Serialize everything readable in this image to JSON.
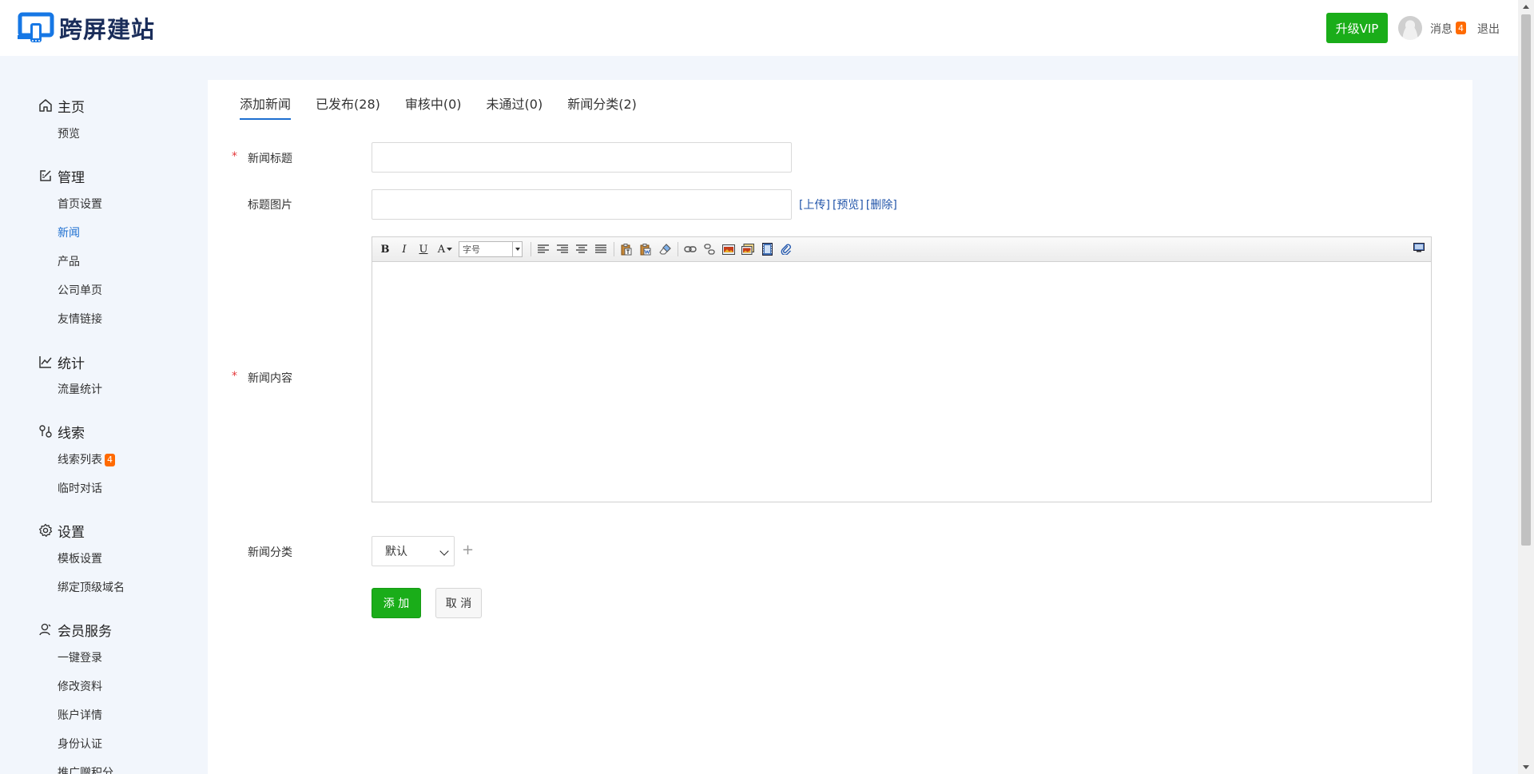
{
  "brand": {
    "name": "跨屏建站",
    "color": "#1677e5"
  },
  "header": {
    "vip_label": "升级VIP",
    "messages_label": "消息",
    "messages_count": "4",
    "logout_label": "退出"
  },
  "sidebar": {
    "sections": [
      {
        "title": "主页",
        "icon": "home-icon",
        "items": [
          "预览"
        ]
      },
      {
        "title": "管理",
        "icon": "edit-icon",
        "items": [
          "首页设置",
          "新闻",
          "产品",
          "公司单页",
          "友情链接"
        ],
        "active": "新闻"
      },
      {
        "title": "统计",
        "icon": "chart-line-icon",
        "items": [
          "流量统计"
        ]
      },
      {
        "title": "线索",
        "icon": "clue-icon",
        "items": [
          "线索列表",
          "临时对话"
        ],
        "badge": {
          "item": "线索列表",
          "count": "4"
        }
      },
      {
        "title": "设置",
        "icon": "gear-icon",
        "items": [
          "模板设置",
          "绑定顶级域名"
        ]
      },
      {
        "title": "会员服务",
        "icon": "user-icon",
        "items": [
          "一键登录",
          "修改资料",
          "账户详情",
          "身份认证",
          "推广赠积分"
        ]
      }
    ]
  },
  "tabs": [
    "添加新闻",
    "已发布(28)",
    "审核中(0)",
    "未通过(0)",
    "新闻分类(2)"
  ],
  "active_tab": "添加新闻",
  "form": {
    "required_mark": "*",
    "title_label": "新闻标题",
    "title_value": "",
    "image_label": "标题图片",
    "image_value": "",
    "image_links": [
      "[上传]",
      "[预览]",
      "[删除]"
    ],
    "content_label": "新闻内容",
    "editor": {
      "font_size_placeholder": "字号",
      "buttons": [
        "B",
        "I",
        "U",
        "A"
      ]
    },
    "category_label": "新闻分类",
    "category_value": "默认",
    "category_add": "+",
    "submit_label": "添 加",
    "cancel_label": "取 消"
  },
  "colors": {
    "primary_green": "#1aad19",
    "link_blue": "#1d6fd0",
    "badge_orange": "#ff6a00",
    "required_red": "#e4393c"
  }
}
